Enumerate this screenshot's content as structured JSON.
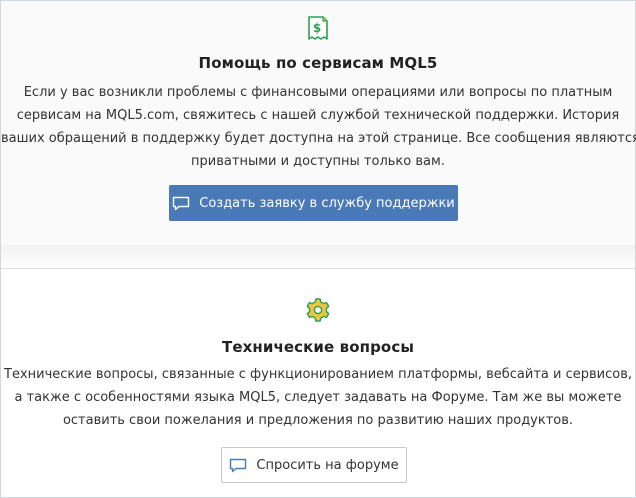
{
  "support_section": {
    "icon": "receipt-dollar-icon",
    "title": "Помощь по сервисам MQL5",
    "lines": [
      "Если у вас возникли проблемы с финансовыми операциями или вопросы по платным",
      "сервисам на MQL5.com, свяжитесь с нашей службой технической поддержки. История",
      "ваших обращений в поддержку будет доступна на этой странице. Все сообщения являются",
      "приватными и доступны только вам."
    ],
    "button_label": "Создать заявку в службу поддержки",
    "button_icon": "chat-icon"
  },
  "tech_section": {
    "icon": "gear-icon",
    "title": "Технические вопросы",
    "lines": [
      "Технические вопросы, связанные с функционированием платформы, вебсайта и сервисов,",
      "а также с особенностями языка MQL5, следует задавать на Форуме. Там же вы можете",
      "оставить свои пожелания и предложения по развитию наших продуктов."
    ],
    "button_label": "Спросить на форуме",
    "button_icon": "chat-icon"
  },
  "colors": {
    "accent": "#4a79b8",
    "icon_green": "#2f9e55",
    "icon_yellow": "#e8c640"
  }
}
